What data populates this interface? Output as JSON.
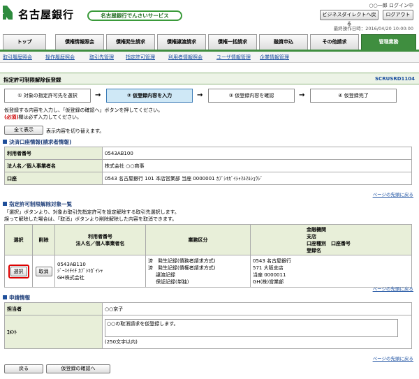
{
  "header": {
    "bank_name": "名古屋銀行",
    "service_name": "名古屋銀行でんさいサービス",
    "user": "○○一郎 ログイン中",
    "direct_back": "ビジネスダイレクトへ戻る",
    "logout": "ログアウト",
    "last_operation": "最終操作日時：2016/04/20 10:00:00"
  },
  "tabs": [
    "トップ",
    "債権情報照会",
    "債権発生請求",
    "債権譲渡請求",
    "債権一括請求",
    "融資申込",
    "その他請求",
    "管理業務"
  ],
  "subnav": [
    "取引履歴照会",
    "操作履歴照会",
    "取引先管理",
    "指定許可管理",
    "利用者情報照会",
    "ユーザ情報管理",
    "企業情報管理"
  ],
  "page": {
    "title": "指定許可制限解除仮登録",
    "screen_id": "SCRUSRD1104"
  },
  "steps": [
    "① 対象の指定許可先を選択",
    "② 仮登録内容を入力",
    "③ 仮登録内容を確認",
    "④ 仮登録完了"
  ],
  "instructions": {
    "line1": "仮登録する内容を入力し、「仮登録の確認へ」ボタンを押してください。",
    "req_mark": "(必須)",
    "line2": "欄は必ず入力してください。"
  },
  "show_all": {
    "button": "全て表示",
    "desc": "表示内容を切り替えます。"
  },
  "settlement": {
    "heading": "決済口座情報(請求者情報)",
    "rows": [
      {
        "label": "利用者番号",
        "value": "0543AB100"
      },
      {
        "label": "法人名／個人事業者名",
        "value": "株式会社 ○○商事"
      },
      {
        "label": "口座",
        "value": "0543 名古屋銀行 101 本店営業部 当座 0000001 ｶﾌﾞｼｷｶﾞｲｼｬﾏﾙﾏﾙｼｮｳｼﾞ"
      }
    ]
  },
  "page_top": "ページの先頭に戻る",
  "targets": {
    "heading": "指定許可制限解除対象一覧",
    "note1": "「選択」ボタンより、対象お取引先指定許可を設定解除する取引先選択します。",
    "note2": "誤って解除した場合は、「取消」ボタンより削除解除した内容を取消できます。",
    "headers": {
      "select": "選択",
      "delete": "削除",
      "user": "利用者番号\n法人名／個人事業者名",
      "business": "業務区分",
      "bank": "金融機関\n支店\n口座種別　口座番号\n登録名"
    },
    "row": {
      "select_btn": "選択",
      "cancel_btn": "取消",
      "user_no": "0543AB110",
      "user_kana": "ｼﾞｰｴｲﾁｲﾁ ｶﾌﾞｼｷｶﾞｲｼｬ",
      "user_name": "GH株式会社",
      "flags": [
        "済",
        "済"
      ],
      "business": [
        "発生記録(債務者請求方式)",
        "発生記録(債権者請求方式)",
        "譲渡記録",
        "保証記録(単独)"
      ],
      "bank": [
        "0543 名古屋銀行",
        "571 大阪支店",
        "当座 0000011",
        "GH(株)営業部"
      ]
    }
  },
  "application": {
    "heading": "申請情報",
    "person_label": "担当者",
    "person_value": "○○京子",
    "comment_label": "ｺﾒﾝﾄ",
    "comment_value": "○○の取消請求を仮登録します。",
    "comment_limit": "(250文字以内)"
  },
  "footer": {
    "back": "戻る",
    "confirm": "仮登録の確認へ"
  }
}
